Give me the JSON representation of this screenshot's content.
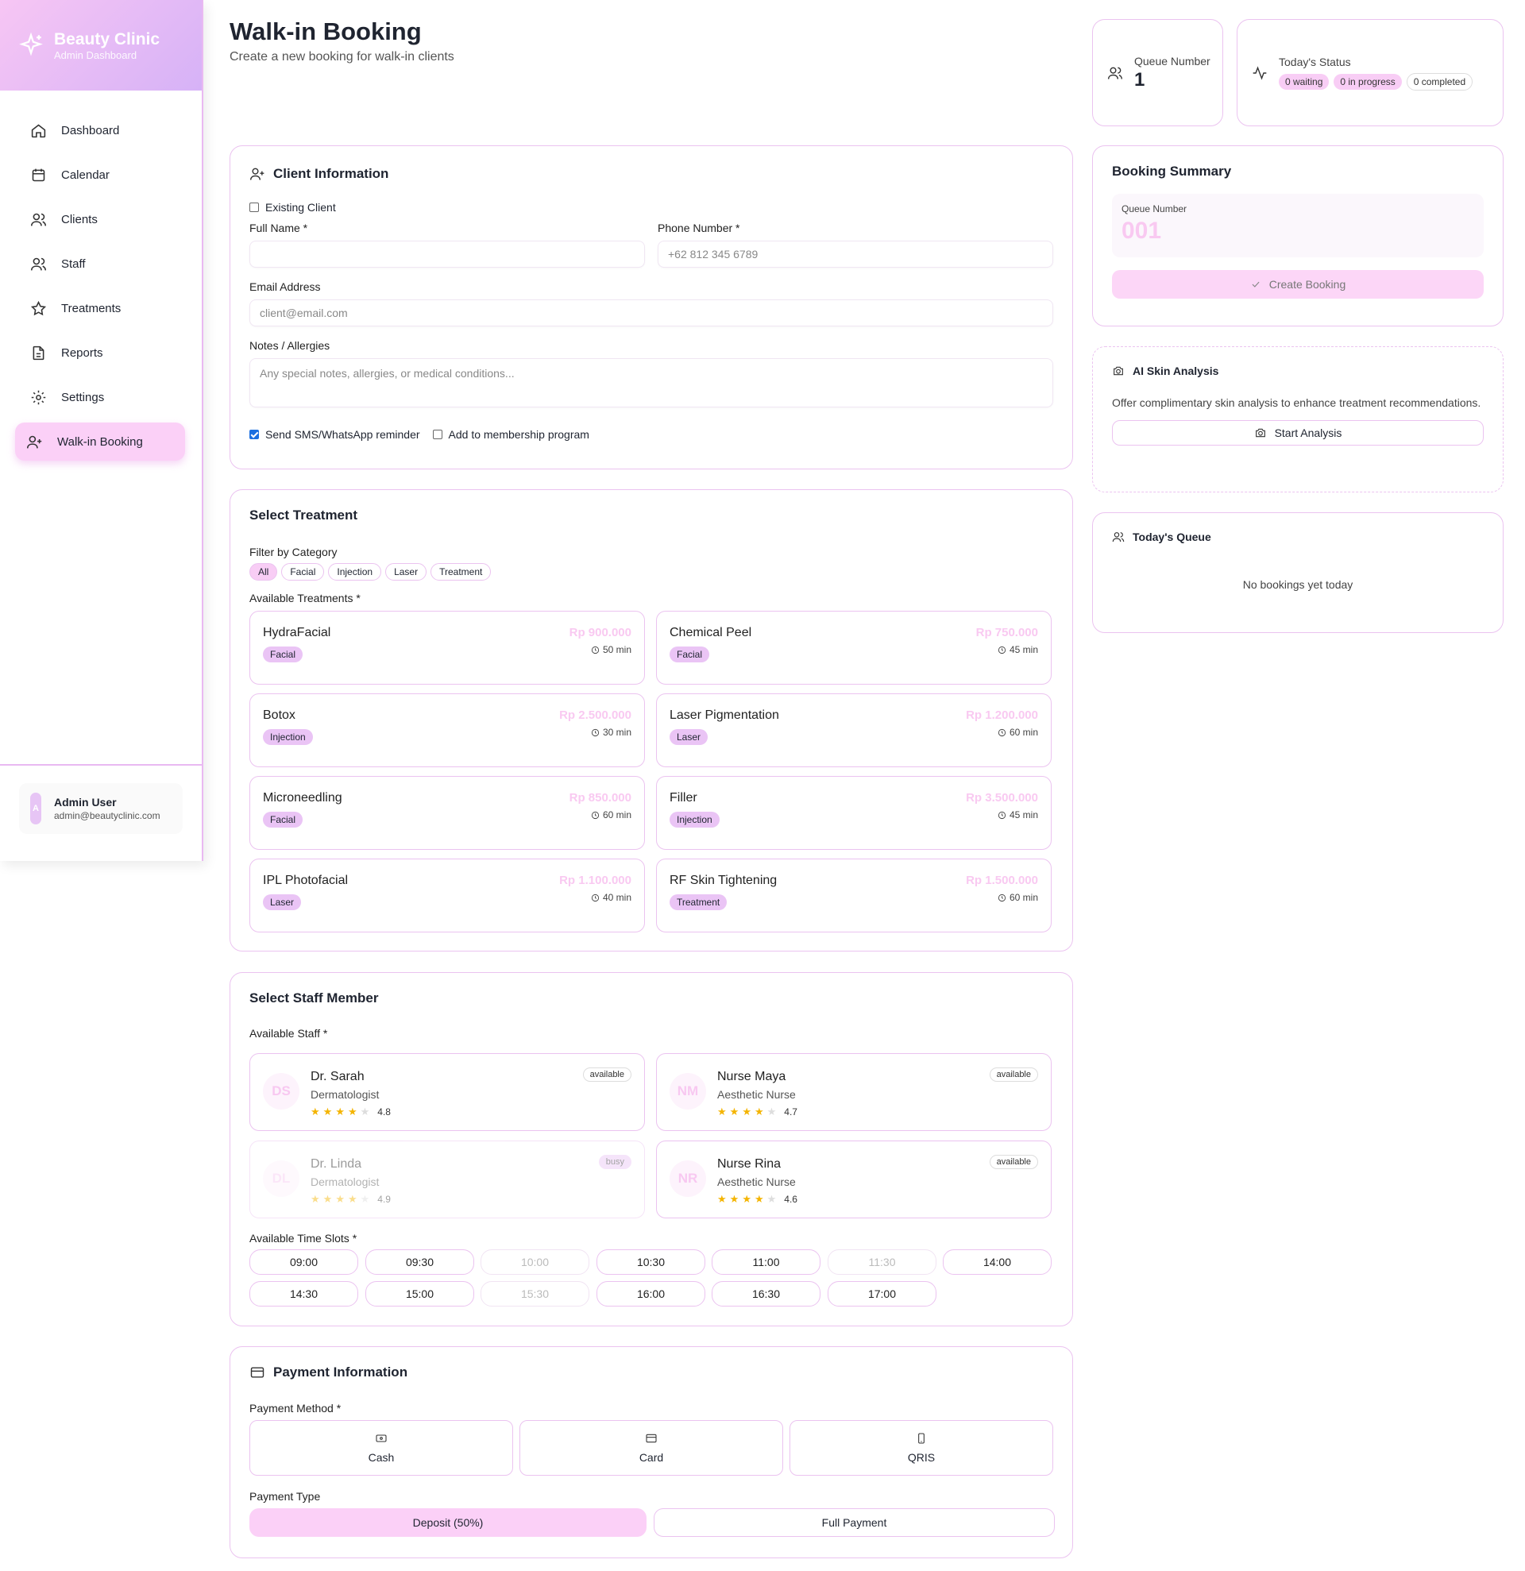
{
  "brand": {
    "title": "Beauty Clinic",
    "subtitle": "Admin Dashboard"
  },
  "nav": [
    {
      "label": "Dashboard",
      "icon": "home-icon"
    },
    {
      "label": "Calendar",
      "icon": "calendar-icon"
    },
    {
      "label": "Clients",
      "icon": "users-icon"
    },
    {
      "label": "Staff",
      "icon": "user-group-icon"
    },
    {
      "label": "Treatments",
      "icon": "star-icon"
    },
    {
      "label": "Reports",
      "icon": "file-icon"
    },
    {
      "label": "Settings",
      "icon": "gear-icon"
    },
    {
      "label": "Walk-in Booking",
      "icon": "user-plus-icon",
      "active": true
    }
  ],
  "user": {
    "initial": "A",
    "name": "Admin User",
    "email": "admin@beautyclinic.com"
  },
  "header": {
    "title": "Walk-in Booking",
    "subtitle": "Create a new booking for walk-in clients"
  },
  "queue_stat": {
    "label": "Queue Number",
    "value": "1"
  },
  "status_stat": {
    "label": "Today's Status",
    "waiting": "0 waiting",
    "in_progress": "0 in progress",
    "completed": "0 completed"
  },
  "client": {
    "title": "Client Information",
    "existing_label": "Existing Client",
    "full_name_label": "Full Name *",
    "full_name_value": "",
    "phone_label": "Phone Number *",
    "phone_placeholder": "+62 812 345 6789",
    "email_label": "Email Address",
    "email_placeholder": "client@email.com",
    "notes_label": "Notes / Allergies",
    "notes_placeholder": "Any special notes, allergies, or medical conditions...",
    "sms_label": "Send SMS/WhatsApp reminder",
    "sms_checked": true,
    "membership_label": "Add to membership program",
    "membership_checked": false
  },
  "treatment": {
    "title": "Select Treatment",
    "filter_label": "Filter by Category",
    "filters": [
      "All",
      "Facial",
      "Injection",
      "Laser",
      "Treatment"
    ],
    "active_filter": "All",
    "available_label": "Available Treatments *",
    "items": [
      {
        "name": "HydraFacial",
        "tag": "Facial",
        "price": "Rp 900.000",
        "duration": "50 min"
      },
      {
        "name": "Chemical Peel",
        "tag": "Facial",
        "price": "Rp 750.000",
        "duration": "45 min"
      },
      {
        "name": "Botox",
        "tag": "Injection",
        "price": "Rp 2.500.000",
        "duration": "30 min"
      },
      {
        "name": "Laser Pigmentation",
        "tag": "Laser",
        "price": "Rp 1.200.000",
        "duration": "60 min"
      },
      {
        "name": "Microneedling",
        "tag": "Facial",
        "price": "Rp 850.000",
        "duration": "60 min"
      },
      {
        "name": "Filler",
        "tag": "Injection",
        "price": "Rp 3.500.000",
        "duration": "45 min"
      },
      {
        "name": "IPL Photofacial",
        "tag": "Laser",
        "price": "Rp 1.100.000",
        "duration": "40 min"
      },
      {
        "name": "RF Skin Tightening",
        "tag": "Treatment",
        "price": "Rp 1.500.000",
        "duration": "60 min"
      }
    ]
  },
  "staff": {
    "title": "Select Staff Member",
    "available_label": "Available Staff *",
    "members": [
      {
        "initials": "DS",
        "name": "Dr. Sarah",
        "role": "Dermatologist",
        "rating": "4.8",
        "stars": 4,
        "status": "available"
      },
      {
        "initials": "NM",
        "name": "Nurse Maya",
        "role": "Aesthetic Nurse",
        "rating": "4.7",
        "stars": 4,
        "status": "available"
      },
      {
        "initials": "DL",
        "name": "Dr. Linda",
        "role": "Dermatologist",
        "rating": "4.9",
        "stars": 4,
        "status": "busy"
      },
      {
        "initials": "NR",
        "name": "Nurse Rina",
        "role": "Aesthetic Nurse",
        "rating": "4.6",
        "stars": 4,
        "status": "available"
      }
    ],
    "slots_label": "Available Time Slots *",
    "slots": [
      {
        "time": "09:00",
        "disabled": false
      },
      {
        "time": "09:30",
        "disabled": false
      },
      {
        "time": "10:00",
        "disabled": true
      },
      {
        "time": "10:30",
        "disabled": false
      },
      {
        "time": "11:00",
        "disabled": false
      },
      {
        "time": "11:30",
        "disabled": true
      },
      {
        "time": "14:00",
        "disabled": false
      },
      {
        "time": "14:30",
        "disabled": false
      },
      {
        "time": "15:00",
        "disabled": false
      },
      {
        "time": "15:30",
        "disabled": true
      },
      {
        "time": "16:00",
        "disabled": false
      },
      {
        "time": "16:30",
        "disabled": false
      },
      {
        "time": "17:00",
        "disabled": false
      }
    ]
  },
  "payment": {
    "title": "Payment Information",
    "method_label": "Payment Method *",
    "methods": [
      {
        "label": "Cash",
        "icon": "banknote-icon"
      },
      {
        "label": "Card",
        "icon": "credit-card-icon"
      },
      {
        "label": "QRIS",
        "icon": "phone-icon"
      }
    ],
    "type_label": "Payment Type",
    "types": [
      {
        "label": "Deposit (50%)",
        "selected": true
      },
      {
        "label": "Full Payment",
        "selected": false
      }
    ]
  },
  "summary": {
    "title": "Booking Summary",
    "queue_label": "Queue Number",
    "queue_value": "001",
    "create_label": "Create Booking"
  },
  "ai": {
    "title": "AI Skin Analysis",
    "description": "Offer complimentary skin analysis to enhance treatment recommendations.",
    "button_label": "Start Analysis"
  },
  "today_queue": {
    "title": "Today's Queue",
    "empty_text": "No bookings yet today"
  },
  "colors": {
    "accent": "#fbd0f7",
    "border": "#ebc3f0",
    "price": "#f9c9f1",
    "tag": "#eac4f5"
  }
}
